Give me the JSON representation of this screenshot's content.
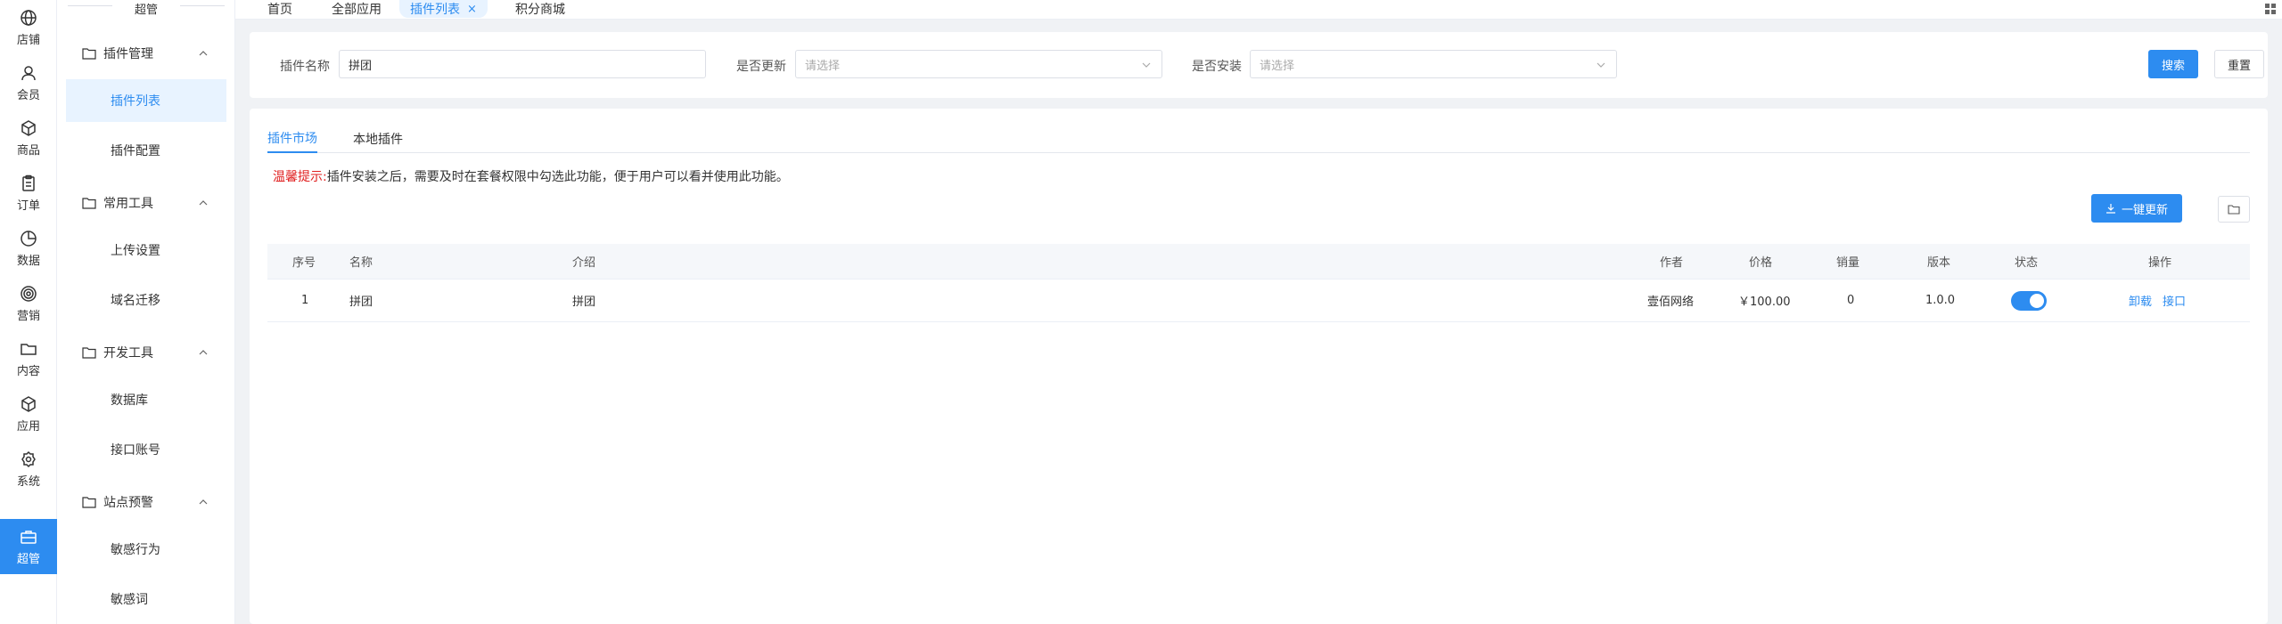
{
  "rail": {
    "items": [
      {
        "label": "店铺",
        "icon": "globe-icon"
      },
      {
        "label": "会员",
        "icon": "user-icon"
      },
      {
        "label": "商品",
        "icon": "box-icon"
      },
      {
        "label": "订单",
        "icon": "clipboard-icon"
      },
      {
        "label": "数据",
        "icon": "pie-icon"
      },
      {
        "label": "营销",
        "icon": "target-icon"
      },
      {
        "label": "内容",
        "icon": "folder-icon"
      },
      {
        "label": "应用",
        "icon": "cube-icon"
      },
      {
        "label": "系统",
        "icon": "gear-icon"
      },
      {
        "label": "超管",
        "icon": "briefcase-icon"
      }
    ],
    "active_index": 9
  },
  "menu": {
    "title": "超管",
    "groups": [
      {
        "label": "插件管理",
        "items": [
          "插件列表",
          "插件配置"
        ]
      },
      {
        "label": "常用工具",
        "items": [
          "上传设置",
          "域名迁移"
        ]
      },
      {
        "label": "开发工具",
        "items": [
          "数据库",
          "接口账号"
        ]
      },
      {
        "label": "站点预警",
        "items": [
          "敏感行为",
          "敏感词"
        ]
      }
    ],
    "active_item": "插件列表"
  },
  "topbar": {
    "tabs": [
      {
        "label": "首页"
      },
      {
        "label": "全部应用"
      },
      {
        "label": "插件列表",
        "closable": "×"
      },
      {
        "label": "积分商城"
      }
    ],
    "active_index": 2
  },
  "filter": {
    "name_label": "插件名称",
    "name_value": "拼团",
    "update_label": "是否更新",
    "update_placeholder": "请选择",
    "install_label": "是否安装",
    "install_placeholder": "请选择",
    "search_btn": "搜索",
    "reset_btn": "重置"
  },
  "main": {
    "tabs": [
      "插件市场",
      "本地插件"
    ],
    "active_tab": 0,
    "tip_title": "温馨提示:",
    "tip_text": "插件安装之后，需要及时在套餐权限中勾选此功能，便于用户可以看并使用此功能。",
    "update_all_btn": "一键更新"
  },
  "table": {
    "columns": [
      "序号",
      "名称",
      "介绍",
      "作者",
      "价格",
      "销量",
      "版本",
      "状态",
      "操作"
    ],
    "rows": [
      {
        "index": "1",
        "name": "拼团",
        "intro": "拼团",
        "author": "壹佰网络",
        "price": "￥100.00",
        "sales": "0",
        "version": "1.0.0",
        "status_on": true,
        "actions": [
          "卸载",
          "接口"
        ]
      }
    ]
  },
  "colors": {
    "primary": "#2d8cf0",
    "warning": "#e02020",
    "active_bg": "#e8f3ff"
  }
}
